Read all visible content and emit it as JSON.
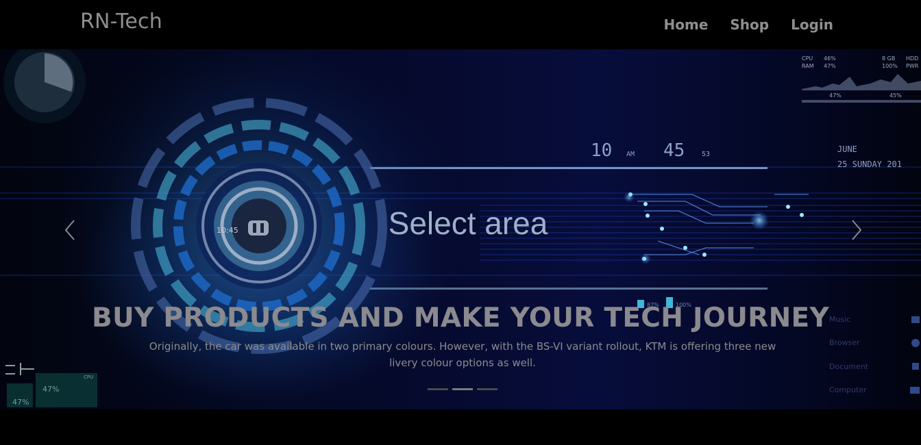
{
  "navbar": {
    "brand": "RN-Tech",
    "links": [
      "Home",
      "Shop",
      "Login"
    ]
  },
  "hero": {
    "overlay_text": "Select area",
    "clock_hour": "10",
    "clock_am": "AM",
    "clock_minute": "45",
    "clock_second": "53",
    "date_month": "JUNE",
    "date_day": "25 SUNDAY 201",
    "dial_time": "10:45",
    "stats_cpu": "CPU",
    "stats_cpu_val": "46%",
    "stats_ram": "RAM",
    "stats_ram_val": "47%",
    "stats_gb": "8 GB",
    "stats_hdd": "HDD",
    "stats_pct": "100%",
    "stats_pwr": "PWR",
    "graph_left": "47%",
    "graph_right": "45%",
    "mini_pct1": "87%",
    "mini_pct2": "100%",
    "side_menu": [
      "Music",
      "Browser",
      "Document",
      "Computer"
    ],
    "widget_pct_top": "47%",
    "widget_pct_bottom": "47%",
    "widget_cpu": "CPU"
  },
  "caption": {
    "title": "BUY PRODUCTS AND MAKE YOUR TECH JOURNEY",
    "text": "Originally, the car was available in two primary colours. However, with the BS-VI variant rollout, KTM is offering three new livery colour options as well."
  },
  "carousel": {
    "slide_count": 3,
    "active_index": 1,
    "prev_label": "‹",
    "next_label": "›"
  },
  "colors": {
    "background": "#000000",
    "text_muted": "#8c8c8c",
    "accent_blue": "#2a5fd0",
    "accent_cyan": "#3fb8d8"
  }
}
